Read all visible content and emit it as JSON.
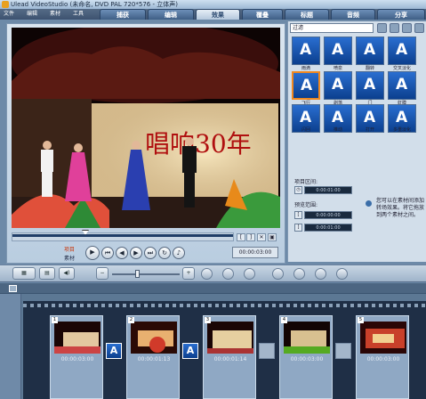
{
  "window": {
    "title": "Ulead VideoStudio (未命名, DVD PAL 720*576 - 立体声)"
  },
  "menu": [
    "文件",
    "编辑",
    "素材",
    "工具"
  ],
  "steps": [
    {
      "label": "捕获",
      "active": false
    },
    {
      "label": "编辑",
      "active": false
    },
    {
      "label": "效果",
      "active": true
    },
    {
      "label": "覆叠",
      "active": false
    },
    {
      "label": "标题",
      "active": false
    },
    {
      "label": "音频",
      "active": false
    },
    {
      "label": "分享",
      "active": false
    }
  ],
  "preview": {
    "mode_project": "项目",
    "mode_clip": "素材",
    "timecode": "00:00:03:00",
    "stage_banner": "唱响30年"
  },
  "filters": {
    "selected_category": "过滤",
    "items": [
      "雨滴",
      "喷泉",
      "翻转",
      "交叉淡化",
      "飞行",
      "剥落",
      "门",
      "虹膜",
      "闪回",
      "推动",
      "打开",
      "多重淡化"
    ]
  },
  "properties": {
    "duration_label": "项目区间:",
    "duration_value": "0:00:01:00",
    "preview_range_label": "预览范围:",
    "range_start": "0:00:00:00",
    "range_end": "0:00:01:00",
    "hint": "您可以在素材间添加转场效果。将它拖放到两个素材之间。"
  },
  "timeline": {
    "clips": [
      {
        "num": "1",
        "timecode": "00:00:03:00"
      },
      {
        "num": "2",
        "timecode": "00:00:01:13"
      },
      {
        "num": "3",
        "timecode": "00:00:01:14"
      },
      {
        "num": "4",
        "timecode": "00:00:03:00"
      },
      {
        "num": "5",
        "timecode": "00:00:03:00"
      }
    ],
    "transitions": [
      "A",
      "A"
    ]
  },
  "colors": {
    "accent": "#2c5ea8",
    "selection": "#f08820"
  }
}
